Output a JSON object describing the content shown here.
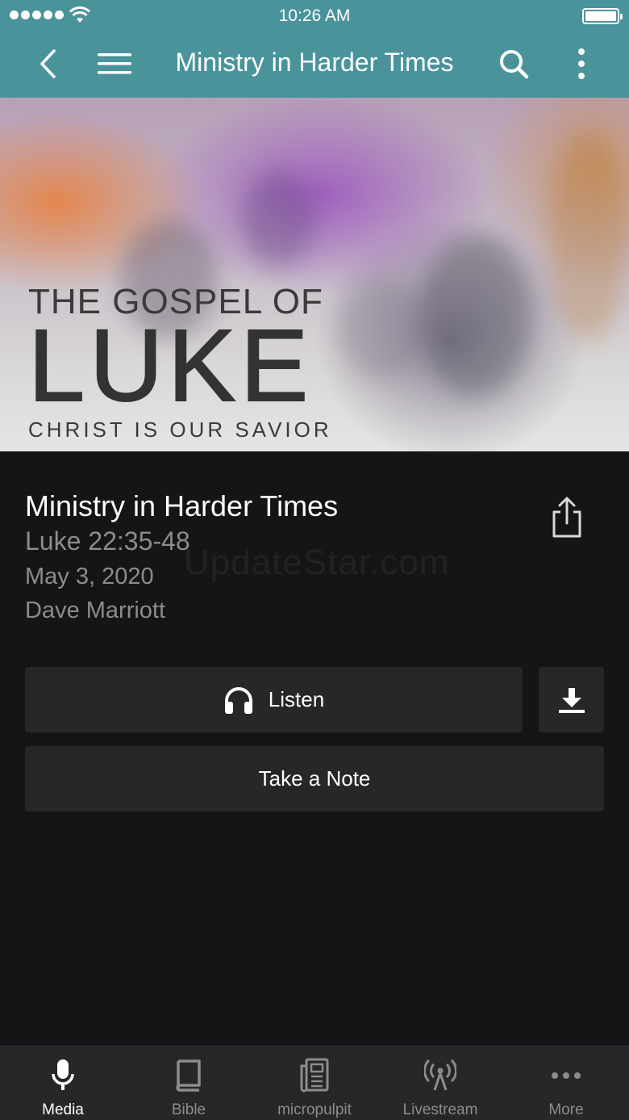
{
  "status_bar": {
    "time": "10:26 AM"
  },
  "header": {
    "title": "Ministry in Harder Times"
  },
  "hero": {
    "line1": "THE GOSPEL OF",
    "line2": "LUKE",
    "line3": "CHRIST IS OUR SAVIOR"
  },
  "sermon": {
    "title": "Ministry in Harder Times",
    "passage": "Luke 22:35-48",
    "date": "May 3, 2020",
    "speaker": "Dave Marriott"
  },
  "watermark": "UpdateStar.com",
  "actions": {
    "listen_label": "Listen",
    "note_label": "Take a Note"
  },
  "tabs": [
    {
      "label": "Media",
      "icon": "microphone-icon",
      "active": true
    },
    {
      "label": "Bible",
      "icon": "book-icon",
      "active": false
    },
    {
      "label": "micropulpit",
      "icon": "newspaper-icon",
      "active": false
    },
    {
      "label": "Livestream",
      "icon": "broadcast-icon",
      "active": false
    },
    {
      "label": "More",
      "icon": "ellipsis-icon",
      "active": false
    }
  ],
  "colors": {
    "header_bg": "#4a939b",
    "page_bg": "#141517",
    "button_bg": "#262729",
    "muted_text": "#8b8c8e"
  }
}
